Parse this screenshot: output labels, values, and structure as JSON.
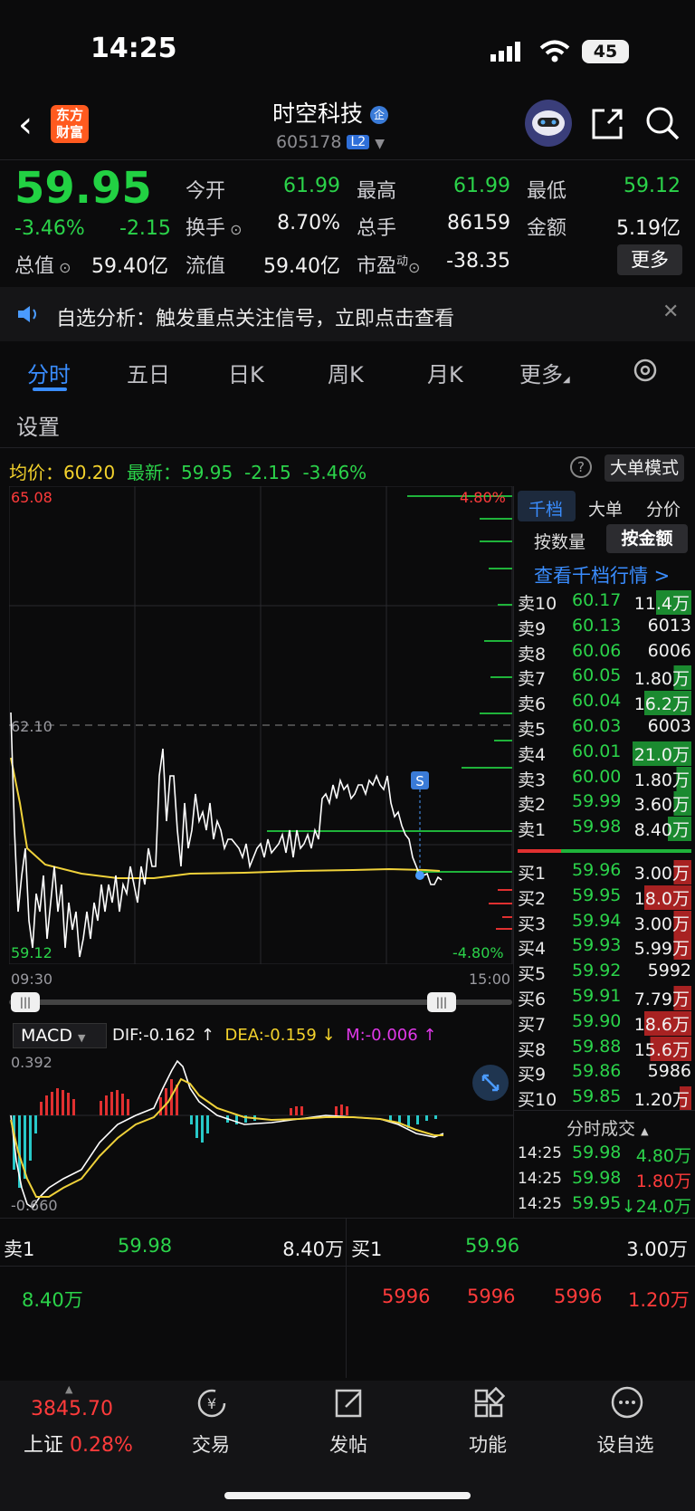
{
  "status_bar": {
    "time": "14:25",
    "battery": "45"
  },
  "header": {
    "name": "时空科技",
    "code": "605178",
    "level": "L2"
  },
  "quote": {
    "price": "59.95",
    "change_pct": "-3.46%",
    "change": "-2.15",
    "open_label": "今开",
    "open": "61.99",
    "high_label": "最高",
    "high": "61.99",
    "low_label": "最低",
    "low": "59.12",
    "turnover_label": "换手",
    "turnover": "8.70%",
    "volume_label": "总手",
    "volume": "86159",
    "amount_label": "金额",
    "amount": "5.19亿",
    "mktcap_label": "总值",
    "mktcap": "59.40亿",
    "float_label": "流值",
    "float": "59.40亿",
    "pe_label": "市盈",
    "pe_sup": "动",
    "pe": "-38.35",
    "more": "更多"
  },
  "notice": {
    "text": "自选分析：触发重点关注信号，立即点击查看"
  },
  "tabs": [
    "分时",
    "五日",
    "日K",
    "周K",
    "月K",
    "更多"
  ],
  "settings_label": "设置",
  "info": {
    "avg_label": "均价：",
    "avg": "60.20",
    "latest_label": "最新：",
    "latest": "59.95",
    "chg": "-2.15",
    "pct": "-3.46%",
    "big_mode": "大单模式"
  },
  "chart_data": {
    "type": "line",
    "y_top": "65.08",
    "y_bottom": "59.12",
    "y_ref": "62.10",
    "pct_top": "4.80%",
    "pct_bottom": "-4.80%",
    "x_start": "09:30",
    "x_end": "15:00",
    "marker": "S"
  },
  "macd": {
    "label": "MACD",
    "dif": "DIF:-0.162 ↑",
    "dea": "DEA:-0.159 ↓",
    "m": "M:-0.006 ↑",
    "top": "0.392",
    "bottom": "-0.660"
  },
  "orderbook": {
    "tabs": [
      "千档",
      "大单",
      "分价"
    ],
    "subtabs": [
      "按数量",
      "按金额"
    ],
    "link": "查看千档行情 >",
    "asks": [
      {
        "label": "卖10",
        "price": "60.17",
        "vol": "11.4万"
      },
      {
        "label": "卖9",
        "price": "60.13",
        "vol": "6013"
      },
      {
        "label": "卖8",
        "price": "60.06",
        "vol": "6006"
      },
      {
        "label": "卖7",
        "price": "60.05",
        "vol": "1.80万"
      },
      {
        "label": "卖6",
        "price": "60.04",
        "vol": "16.2万"
      },
      {
        "label": "卖5",
        "price": "60.03",
        "vol": "6003"
      },
      {
        "label": "卖4",
        "price": "60.01",
        "vol": "21.0万"
      },
      {
        "label": "卖3",
        "price": "60.00",
        "vol": "1.80万"
      },
      {
        "label": "卖2",
        "price": "59.99",
        "vol": "3.60万"
      },
      {
        "label": "卖1",
        "price": "59.98",
        "vol": "8.40万"
      }
    ],
    "bids": [
      {
        "label": "买1",
        "price": "59.96",
        "vol": "3.00万"
      },
      {
        "label": "买2",
        "price": "59.95",
        "vol": "18.0万"
      },
      {
        "label": "买3",
        "price": "59.94",
        "vol": "3.00万"
      },
      {
        "label": "买4",
        "price": "59.93",
        "vol": "5.99万"
      },
      {
        "label": "买5",
        "price": "59.92",
        "vol": "5992"
      },
      {
        "label": "买6",
        "price": "59.91",
        "vol": "7.79万"
      },
      {
        "label": "买7",
        "price": "59.90",
        "vol": "18.6万"
      },
      {
        "label": "买8",
        "price": "59.88",
        "vol": "15.6万"
      },
      {
        "label": "买9",
        "price": "59.86",
        "vol": "5986"
      },
      {
        "label": "买10",
        "price": "59.85",
        "vol": "1.20万"
      }
    ],
    "trades_title": "分时成交",
    "trades": [
      {
        "time": "14:25",
        "price": "59.98",
        "vol": "4.80万",
        "color": "#2bd34a"
      },
      {
        "time": "14:25",
        "price": "59.98",
        "vol": "1.80万",
        "color": "#ff3b3b"
      },
      {
        "time": "14:25",
        "price": "59.95",
        "vol": "↓24.0万",
        "color": "#2bd34a"
      }
    ]
  },
  "bottom_panel": {
    "sell1_label": "卖1",
    "sell1_price": "59.98",
    "sell1_vol": "8.40万",
    "buy1_label": "买1",
    "buy1_price": "59.96",
    "buy1_vol": "3.00万",
    "sell_queue": [
      "8.40万"
    ],
    "buy_queue": [
      "5996",
      "5996",
      "5996",
      "1.20万"
    ]
  },
  "bottom_bar": {
    "index_value": "3845.70",
    "index_name": "上证",
    "index_pct": "0.28%",
    "items": [
      "交易",
      "发帖",
      "功能",
      "设自选"
    ]
  }
}
